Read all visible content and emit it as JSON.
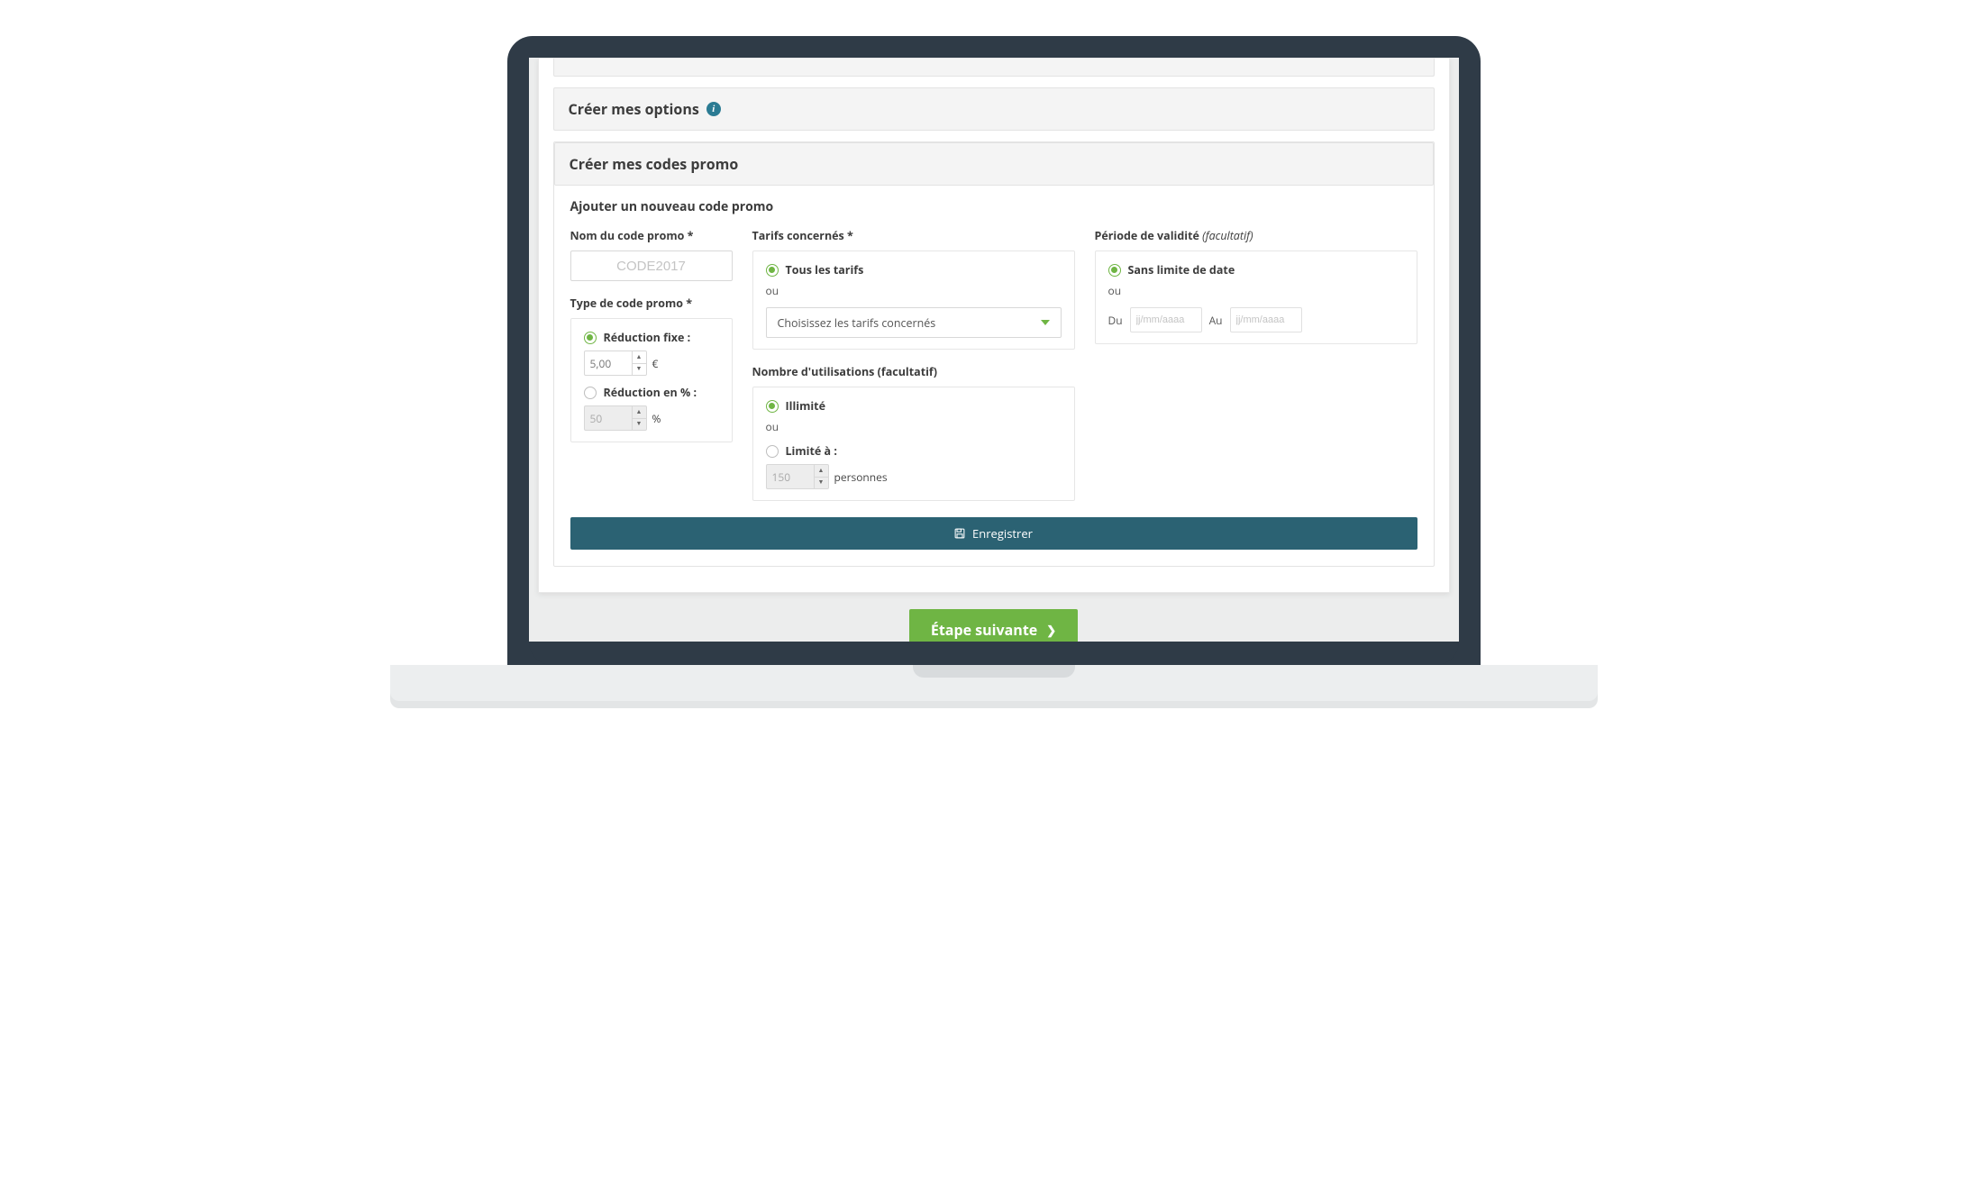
{
  "panels": {
    "options_title": "Créer mes options",
    "promo_title": "Créer mes codes promo"
  },
  "promo": {
    "subtitle": "Ajouter un nouveau code promo",
    "name_label": "Nom du code promo *",
    "name_placeholder": "CODE2017",
    "type_label": "Type de code promo *",
    "reduction_fixed": "Réduction fixe :",
    "reduction_fixed_value": "5,00",
    "reduction_fixed_unit": "€",
    "reduction_pct": "Réduction en % :",
    "reduction_pct_value": "50",
    "reduction_pct_unit": "%"
  },
  "tarifs": {
    "label": "Tarifs concernés *",
    "all": "Tous les tarifs",
    "ou": "ou",
    "select_placeholder": "Choisissez les tarifs concernés"
  },
  "uses": {
    "label": "Nombre d'utilisations (facultatif)",
    "unlimited": "Illimité",
    "ou": "ou",
    "limited": "Limité à :",
    "limited_value": "150",
    "limited_unit": "personnes"
  },
  "validity": {
    "label_main": "Période de validité",
    "label_optional": "(facultatif)",
    "no_limit": "Sans limite de date",
    "ou": "ou",
    "from": "Du",
    "to": "Au",
    "date_placeholder": "jj/mm/aaaa"
  },
  "actions": {
    "save": "Enregistrer",
    "next": "Étape suivante"
  }
}
